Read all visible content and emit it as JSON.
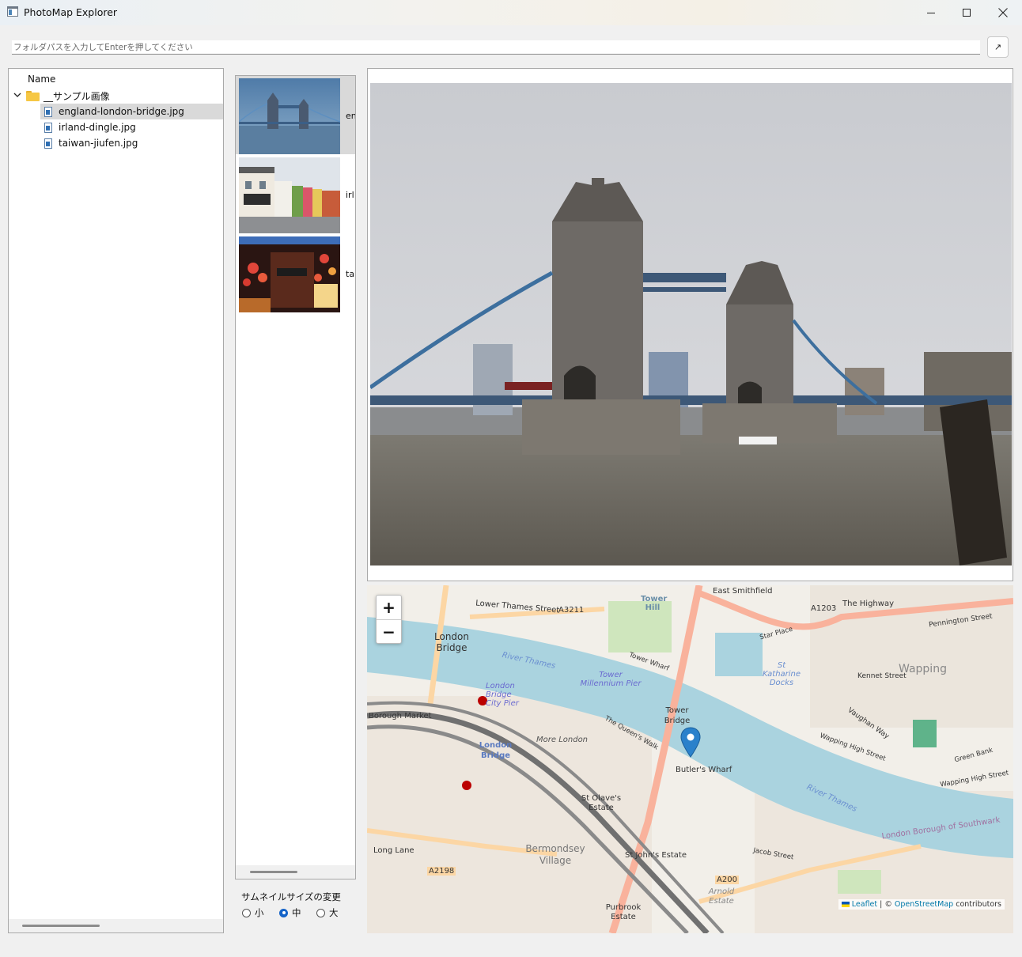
{
  "window": {
    "title": "PhotoMap Explorer"
  },
  "pathbar": {
    "placeholder": "フォルダパスを入力してEnterを押してください",
    "go_label": "↗"
  },
  "tree": {
    "header": "Name",
    "folder": "__サンプル画像",
    "files": [
      "england-london-bridge.jpg",
      "irland-dingle.jpg",
      "taiwan-jiufen.jpg"
    ],
    "selected_index": 0
  },
  "thumbnails": {
    "items": [
      {
        "label": "en",
        "icon": "tower-bridge-thumbnail"
      },
      {
        "label": "irl",
        "icon": "dingle-street-thumbnail"
      },
      {
        "label": "tai",
        "icon": "jiufen-lanterns-thumbnail"
      }
    ],
    "size_title": "サムネイルサイズの変更",
    "sizes": [
      "小",
      "中",
      "大"
    ],
    "selected_size": "中"
  },
  "map": {
    "zoom_in": "+",
    "zoom_out": "−",
    "attribution_leaflet": "Leaflet",
    "attribution_sep": " | © ",
    "attribution_osm": "OpenStreetMap",
    "attribution_tail": " contributors",
    "labels": {
      "london_bridge": "London Bridge",
      "lower_thames": "Lower Thames Street",
      "a3211": "A3211",
      "tower_hill": "Tower Hill",
      "east_smithfield": "East Smithfield",
      "a1203": "A1203",
      "the_highway": "The Highway",
      "pennington": "Pennington Street",
      "river_thames": "River Thames",
      "river_thames2": "River Thames",
      "tower_millennium": "Tower Millennium Pier",
      "st_katharine": "St Katharine Docks",
      "wapping": "Wapping",
      "kennet": "Kennet Street",
      "london_bridge_pier": "London Bridge City Pier",
      "tower_bridge": "Tower Bridge",
      "borough_market": "Borough Market",
      "london_bridge_stn": "London Bridge",
      "more_london": "More London",
      "butlers_wharf": "Butler's Wharf",
      "st_olaves": "St Olave's Estate",
      "bermondsey": "Bermondsey Village",
      "st_johns": "St John's Estate",
      "a200": "A200",
      "a2198": "A2198",
      "long_lane": "Long Lane",
      "purbrook": "Purbrook Estate",
      "arnold": "Arnold Estate",
      "southwark": "London Borough of Southwark",
      "wapping_high": "Wapping High Street",
      "green_bank": "Green Bank",
      "vaughan": "Vaughan Way",
      "star_place": "Star Place",
      "tower_wharf": "Tower Wharf",
      "queens_walk": "The Queen's Walk",
      "jacob": "Jacob Street"
    },
    "marker_icon": "map-pin-icon",
    "colors": {
      "water": "#aad3df",
      "land": "#f2efe9",
      "major_road": "#f9b29c",
      "secondary_road": "#fcd6a4",
      "rail": "#707070",
      "marker": "#2a81cb"
    }
  }
}
